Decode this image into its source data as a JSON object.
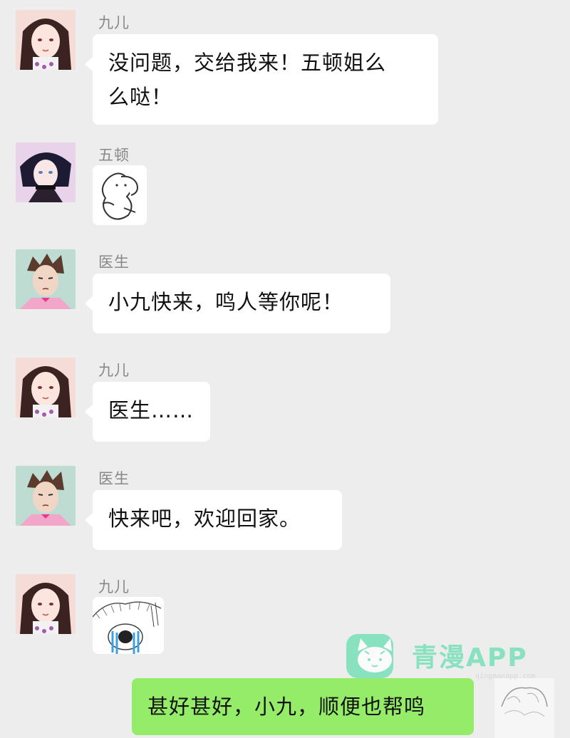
{
  "messages": [
    {
      "sender": "九儿",
      "text_lines": [
        "没问题，交给我来！五顿姐么",
        "么哒！"
      ]
    },
    {
      "sender": "五顿",
      "sticker": "blob-hug-sticker"
    },
    {
      "sender": "医生",
      "text": "小九快来，鸣人等你呢！"
    },
    {
      "sender": "九儿",
      "text": "医生……"
    },
    {
      "sender": "医生",
      "text": "快来吧，欢迎回家。"
    },
    {
      "sender": "九儿",
      "sticker": "crying-cat-sticker"
    }
  ],
  "outgoing": {
    "text": "甚好甚好，小九，顺便也帮鸣"
  },
  "watermark": {
    "text": "青漫APP",
    "sub": "qingmanapp.com"
  },
  "colors": {
    "bg": "#ededed",
    "bubble_in": "#ffffff",
    "bubble_out": "#95ec69",
    "watermark": "#72dfb5"
  }
}
